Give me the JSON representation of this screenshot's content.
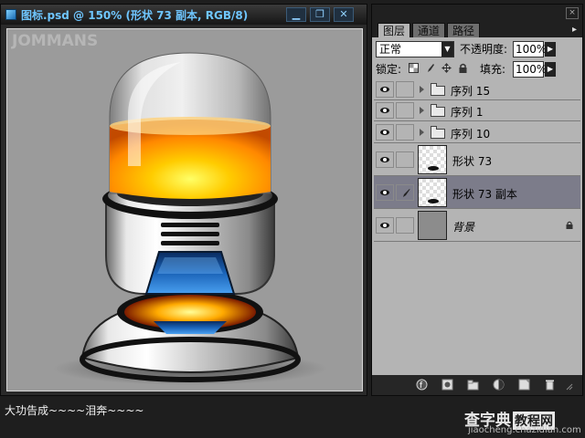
{
  "document": {
    "title": "图标.psd @ 150% (形状 73 副本, RGB/8)",
    "minimize_glyph": "▁",
    "restore_glyph": "❐",
    "close_glyph": "✕",
    "watermark": "JOMMANS"
  },
  "panel": {
    "tabs": [
      {
        "label": "图层",
        "active": true
      },
      {
        "label": "通道",
        "active": false
      },
      {
        "label": "路径",
        "active": false
      }
    ],
    "menu_glyph": "▸",
    "close_glyph": "×",
    "blend_mode": "正常",
    "opacity_label": "不透明度:",
    "opacity_value": "100%",
    "lock_label": "锁定:",
    "fill_label": "填充:",
    "fill_value": "100%",
    "layers": [
      {
        "name": "序列 15",
        "type": "group",
        "visible": true,
        "selected": false
      },
      {
        "name": "序列 1",
        "type": "group",
        "visible": true,
        "selected": false
      },
      {
        "name": "序列 10",
        "type": "group",
        "visible": true,
        "selected": false
      },
      {
        "name": "形状 73",
        "type": "shape",
        "visible": true,
        "selected": false
      },
      {
        "name": "形状 73 副本",
        "type": "shape",
        "visible": true,
        "selected": true
      },
      {
        "name": "背景",
        "type": "background",
        "visible": true,
        "selected": false,
        "locked": true
      }
    ],
    "bottom_icons": [
      "link-layers-icon",
      "layer-style-icon",
      "mask-icon",
      "new-group-icon",
      "adjustment-layer-icon",
      "new-layer-icon",
      "delete-layer-icon"
    ]
  },
  "caption": "大功告成~~~~泪奔~~~~",
  "site": {
    "name": "查字典",
    "boxed": "教程网",
    "url": "jiaocheng.chazidian.com"
  },
  "colors": {
    "title_text": "#6fc6ff",
    "canvas_bg": "#9b9b9b",
    "liquid_orange": "#ff9900",
    "core_blue": "#1a63b8",
    "selected_layer": "#7c7c8a"
  }
}
